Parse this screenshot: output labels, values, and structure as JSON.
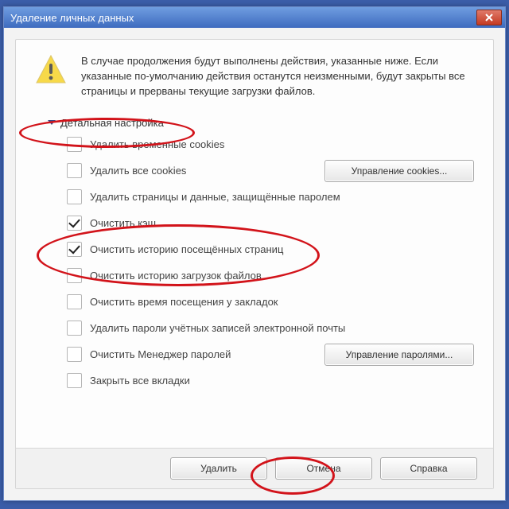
{
  "window": {
    "title": "Удаление личных данных"
  },
  "intro": "В случае продолжения будут выполнены действия, указанные ниже. Если указанные по-умолчанию действия останутся неизменными, будут закрыты все страницы и прерваны текущие загрузки файлов.",
  "expander_label": "Детальная настройка",
  "options": [
    {
      "label": "Удалить временные cookies",
      "checked": false,
      "side_button": null
    },
    {
      "label": "Удалить все cookies",
      "checked": false,
      "side_button": "Управление cookies..."
    },
    {
      "label": "Удалить страницы и данные, защищённые паролем",
      "checked": false,
      "side_button": null
    },
    {
      "label": "Очистить кэш",
      "checked": true,
      "side_button": null
    },
    {
      "label": "Очистить историю посещённых страниц",
      "checked": true,
      "side_button": null
    },
    {
      "label": "Очистить историю загрузок файлов",
      "checked": false,
      "side_button": null
    },
    {
      "label": "Очистить время посещения у закладок",
      "checked": false,
      "side_button": null
    },
    {
      "label": "Удалить пароли учётных записей электронной почты",
      "checked": false,
      "side_button": null
    },
    {
      "label": "Очистить Менеджер паролей",
      "checked": false,
      "side_button": "Управление паролями..."
    },
    {
      "label": "Закрыть все вкладки",
      "checked": false,
      "side_button": null
    }
  ],
  "footer": {
    "delete": "Удалить",
    "cancel": "Отмена",
    "help": "Справка"
  }
}
